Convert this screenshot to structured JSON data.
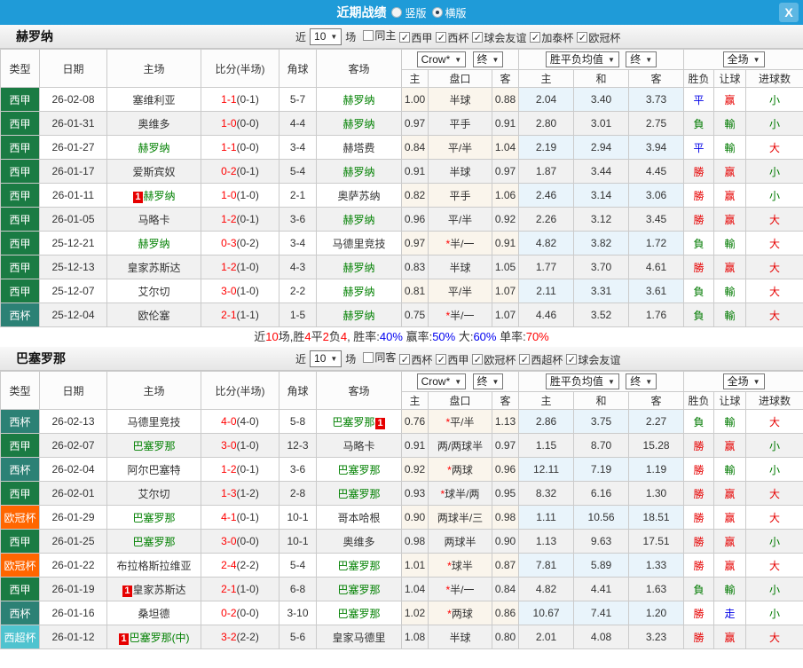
{
  "topbar": {
    "title": "近期战绩",
    "radios": [
      {
        "label": "竖版",
        "selected": false
      },
      {
        "label": "横版",
        "selected": true
      }
    ],
    "close_label": "X"
  },
  "league_colors": {
    "西甲": "#1A7B43",
    "西杯": "#2C8175",
    "欧冠杯": "#FF6600",
    "西超杯": "#4FC3CF"
  },
  "result_colors": {
    "勝": "red",
    "平": "blue",
    "負": "green",
    "赢": "red",
    "輸": "green",
    "走": "blue",
    "大": "red",
    "小": "green"
  },
  "table_header": {
    "main": [
      "类型",
      "日期",
      "主场",
      "比分(半场)",
      "角球",
      "客场"
    ],
    "sub": [
      "主",
      "盘口",
      "客",
      "主",
      "和",
      "客",
      "胜负",
      "让球",
      "进球数"
    ],
    "dropdowns": {
      "crow": "Crow*",
      "final1": "终",
      "avg": "胜平负均值",
      "final2": "终",
      "full": "全场"
    }
  },
  "sections": [
    {
      "team": "赫罗纳",
      "filter": {
        "near_label": "近",
        "count": "10",
        "games_label": "场",
        "checkboxes": [
          {
            "label": "同主",
            "checked": false
          },
          {
            "label": "西甲",
            "checked": true
          },
          {
            "label": "西杯",
            "checked": true
          },
          {
            "label": "球会友谊",
            "checked": true
          },
          {
            "label": "加泰杯",
            "checked": true
          },
          {
            "label": "欧冠杯",
            "checked": true
          }
        ]
      },
      "rows": [
        {
          "type": "西甲",
          "date": "26-02-08",
          "home": "塞维利亚",
          "home_green": false,
          "home_badge": false,
          "away": "赫罗纳",
          "away_green": true,
          "away_badge": false,
          "ft": "1-1",
          "half": "0-1",
          "corners": "5-7",
          "odds1": "1.00",
          "handicap": "半球",
          "odds2": "0.88",
          "avg": [
            "2.04",
            "3.40",
            "3.73"
          ],
          "result": "平",
          "let": "赢",
          "goals": "小"
        },
        {
          "type": "西甲",
          "date": "26-01-31",
          "home": "奥维多",
          "home_green": false,
          "home_badge": false,
          "away": "赫罗纳",
          "away_green": true,
          "away_badge": false,
          "ft": "1-0",
          "half": "0-0",
          "corners": "4-4",
          "odds1": "0.97",
          "handicap": "平手",
          "odds2": "0.91",
          "avg": [
            "2.80",
            "3.01",
            "2.75"
          ],
          "result": "負",
          "let": "輸",
          "goals": "小"
        },
        {
          "type": "西甲",
          "date": "26-01-27",
          "home": "赫罗纳",
          "home_green": true,
          "home_badge": false,
          "away": "赫塔费",
          "away_green": false,
          "away_badge": false,
          "ft": "1-1",
          "half": "0-0",
          "corners": "3-4",
          "odds1": "0.84",
          "handicap": "平/半",
          "odds2": "1.04",
          "avg": [
            "2.19",
            "2.94",
            "3.94"
          ],
          "result": "平",
          "let": "輸",
          "goals": "大"
        },
        {
          "type": "西甲",
          "date": "26-01-17",
          "home": "爱斯宾奴",
          "home_green": false,
          "home_badge": false,
          "away": "赫罗纳",
          "away_green": true,
          "away_badge": false,
          "ft": "0-2",
          "half": "0-1",
          "corners": "5-4",
          "odds1": "0.91",
          "handicap": "半球",
          "odds2": "0.97",
          "avg": [
            "1.87",
            "3.44",
            "4.45"
          ],
          "result": "勝",
          "let": "赢",
          "goals": "小"
        },
        {
          "type": "西甲",
          "date": "26-01-11",
          "home": "赫罗纳",
          "home_green": true,
          "home_badge": true,
          "away": "奥萨苏纳",
          "away_green": false,
          "away_badge": false,
          "ft": "1-0",
          "half": "1-0",
          "corners": "2-1",
          "odds1": "0.82",
          "handicap": "平手",
          "odds2": "1.06",
          "avg": [
            "2.46",
            "3.14",
            "3.06"
          ],
          "result": "勝",
          "let": "赢",
          "goals": "小"
        },
        {
          "type": "西甲",
          "date": "26-01-05",
          "home": "马略卡",
          "home_green": false,
          "home_badge": false,
          "away": "赫罗纳",
          "away_green": true,
          "away_badge": false,
          "ft": "1-2",
          "half": "0-1",
          "corners": "3-6",
          "odds1": "0.96",
          "handicap": "平/半",
          "odds2": "0.92",
          "avg": [
            "2.26",
            "3.12",
            "3.45"
          ],
          "result": "勝",
          "let": "赢",
          "goals": "大"
        },
        {
          "type": "西甲",
          "date": "25-12-21",
          "home": "赫罗纳",
          "home_green": true,
          "home_badge": false,
          "away": "马德里竞技",
          "away_green": false,
          "away_badge": false,
          "ft": "0-3",
          "half": "0-2",
          "corners": "3-4",
          "odds1": "0.97",
          "handicap": "*半/一",
          "odds2": "0.91",
          "avg": [
            "4.82",
            "3.82",
            "1.72"
          ],
          "result": "負",
          "let": "輸",
          "goals": "大"
        },
        {
          "type": "西甲",
          "date": "25-12-13",
          "home": "皇家苏斯达",
          "home_green": false,
          "home_badge": false,
          "away": "赫罗纳",
          "away_green": true,
          "away_badge": false,
          "ft": "1-2",
          "half": "1-0",
          "corners": "4-3",
          "odds1": "0.83",
          "handicap": "半球",
          "odds2": "1.05",
          "avg": [
            "1.77",
            "3.70",
            "4.61"
          ],
          "result": "勝",
          "let": "赢",
          "goals": "大"
        },
        {
          "type": "西甲",
          "date": "25-12-07",
          "home": "艾尔切",
          "home_green": false,
          "home_badge": false,
          "away": "赫罗纳",
          "away_green": true,
          "away_badge": false,
          "ft": "3-0",
          "half": "1-0",
          "corners": "2-2",
          "odds1": "0.81",
          "handicap": "平/半",
          "odds2": "1.07",
          "avg": [
            "2.11",
            "3.31",
            "3.61"
          ],
          "result": "負",
          "let": "輸",
          "goals": "大"
        },
        {
          "type": "西杯",
          "date": "25-12-04",
          "home": "欧伦塞",
          "home_green": false,
          "home_badge": false,
          "away": "赫罗纳",
          "away_green": true,
          "away_badge": false,
          "ft": "2-1",
          "half": "1-1",
          "corners": "1-5",
          "odds1": "0.75",
          "handicap": "*半/一",
          "odds2": "1.07",
          "avg": [
            "4.46",
            "3.52",
            "1.76"
          ],
          "result": "負",
          "let": "輸",
          "goals": "大"
        }
      ],
      "summary": [
        {
          "t": "近",
          "c": "k"
        },
        {
          "t": "10",
          "c": "r"
        },
        {
          "t": "场,胜",
          "c": "k"
        },
        {
          "t": "4",
          "c": "r"
        },
        {
          "t": "平",
          "c": "k"
        },
        {
          "t": "2",
          "c": "r"
        },
        {
          "t": "负",
          "c": "k"
        },
        {
          "t": "4",
          "c": "r"
        },
        {
          "t": ", 胜率:",
          "c": "k"
        },
        {
          "t": "40%",
          "c": "b"
        },
        {
          "t": " 赢率:",
          "c": "k"
        },
        {
          "t": "50%",
          "c": "b"
        },
        {
          "t": " 大:",
          "c": "k"
        },
        {
          "t": "60%",
          "c": "b"
        },
        {
          "t": " 单率:",
          "c": "k"
        },
        {
          "t": "70%",
          "c": "r"
        }
      ]
    },
    {
      "team": "巴塞罗那",
      "filter": {
        "near_label": "近",
        "count": "10",
        "games_label": "场",
        "checkboxes": [
          {
            "label": "同客",
            "checked": false
          },
          {
            "label": "西杯",
            "checked": true
          },
          {
            "label": "西甲",
            "checked": true
          },
          {
            "label": "欧冠杯",
            "checked": true
          },
          {
            "label": "西超杯",
            "checked": true
          },
          {
            "label": "球会友谊",
            "checked": true
          }
        ]
      },
      "rows": [
        {
          "type": "西杯",
          "date": "26-02-13",
          "home": "马德里竞技",
          "home_green": false,
          "home_badge": false,
          "away": "巴塞罗那",
          "away_green": true,
          "away_badge": true,
          "ft": "4-0",
          "half": "4-0",
          "corners": "5-8",
          "odds1": "0.76",
          "handicap": "*平/半",
          "odds2": "1.13",
          "avg": [
            "2.86",
            "3.75",
            "2.27"
          ],
          "result": "負",
          "let": "輸",
          "goals": "大"
        },
        {
          "type": "西甲",
          "date": "26-02-07",
          "home": "巴塞罗那",
          "home_green": true,
          "home_badge": false,
          "away": "马略卡",
          "away_green": false,
          "away_badge": false,
          "ft": "3-0",
          "half": "1-0",
          "corners": "12-3",
          "odds1": "0.91",
          "handicap": "两/两球半",
          "odds2": "0.97",
          "avg": [
            "1.15",
            "8.70",
            "15.28"
          ],
          "result": "勝",
          "let": "赢",
          "goals": "小"
        },
        {
          "type": "西杯",
          "date": "26-02-04",
          "home": "阿尔巴塞特",
          "home_green": false,
          "home_badge": false,
          "away": "巴塞罗那",
          "away_green": true,
          "away_badge": false,
          "ft": "1-2",
          "half": "0-1",
          "corners": "3-6",
          "odds1": "0.92",
          "handicap": "*两球",
          "odds2": "0.96",
          "avg": [
            "12.11",
            "7.19",
            "1.19"
          ],
          "result": "勝",
          "let": "輸",
          "goals": "小"
        },
        {
          "type": "西甲",
          "date": "26-02-01",
          "home": "艾尔切",
          "home_green": false,
          "home_badge": false,
          "away": "巴塞罗那",
          "away_green": true,
          "away_badge": false,
          "ft": "1-3",
          "half": "1-2",
          "corners": "2-8",
          "odds1": "0.93",
          "handicap": "*球半/两",
          "odds2": "0.95",
          "avg": [
            "8.32",
            "6.16",
            "1.30"
          ],
          "result": "勝",
          "let": "赢",
          "goals": "大"
        },
        {
          "type": "欧冠杯",
          "date": "26-01-29",
          "home": "巴塞罗那",
          "home_green": true,
          "home_badge": false,
          "away": "哥本哈根",
          "away_green": false,
          "away_badge": false,
          "ft": "4-1",
          "half": "0-1",
          "corners": "10-1",
          "odds1": "0.90",
          "handicap": "两球半/三",
          "odds2": "0.98",
          "avg": [
            "1.11",
            "10.56",
            "18.51"
          ],
          "result": "勝",
          "let": "赢",
          "goals": "大"
        },
        {
          "type": "西甲",
          "date": "26-01-25",
          "home": "巴塞罗那",
          "home_green": true,
          "home_badge": false,
          "away": "奥维多",
          "away_green": false,
          "away_badge": false,
          "ft": "3-0",
          "half": "0-0",
          "corners": "10-1",
          "odds1": "0.98",
          "handicap": "两球半",
          "odds2": "0.90",
          "avg": [
            "1.13",
            "9.63",
            "17.51"
          ],
          "result": "勝",
          "let": "赢",
          "goals": "小"
        },
        {
          "type": "欧冠杯",
          "date": "26-01-22",
          "home": "布拉格斯拉维亚",
          "home_green": false,
          "home_badge": false,
          "away": "巴塞罗那",
          "away_green": true,
          "away_badge": false,
          "ft": "2-4",
          "half": "2-2",
          "corners": "5-4",
          "odds1": "1.01",
          "handicap": "*球半",
          "odds2": "0.87",
          "avg": [
            "7.81",
            "5.89",
            "1.33"
          ],
          "result": "勝",
          "let": "赢",
          "goals": "大"
        },
        {
          "type": "西甲",
          "date": "26-01-19",
          "home": "皇家苏斯达",
          "home_green": false,
          "home_badge": true,
          "away": "巴塞罗那",
          "away_green": true,
          "away_badge": false,
          "ft": "2-1",
          "half": "1-0",
          "corners": "6-8",
          "odds1": "1.04",
          "handicap": "*半/一",
          "odds2": "0.84",
          "avg": [
            "4.82",
            "4.41",
            "1.63"
          ],
          "result": "負",
          "let": "輸",
          "goals": "小"
        },
        {
          "type": "西杯",
          "date": "26-01-16",
          "home": "桑坦德",
          "home_green": false,
          "home_badge": false,
          "away": "巴塞罗那",
          "away_green": true,
          "away_badge": false,
          "ft": "0-2",
          "half": "0-0",
          "corners": "3-10",
          "odds1": "1.02",
          "handicap": "*两球",
          "odds2": "0.86",
          "avg": [
            "10.67",
            "7.41",
            "1.20"
          ],
          "result": "勝",
          "let": "走",
          "goals": "小"
        },
        {
          "type": "西超杯",
          "date": "26-01-12",
          "home": "巴塞罗那(中)",
          "home_green": true,
          "home_badge": true,
          "away": "皇家马德里",
          "away_green": false,
          "away_badge": false,
          "ft": "3-2",
          "half": "2-2",
          "corners": "5-6",
          "odds1": "1.08",
          "handicap": "半球",
          "odds2": "0.80",
          "avg": [
            "2.01",
            "4.08",
            "3.23"
          ],
          "result": "勝",
          "let": "赢",
          "goals": "大"
        }
      ],
      "summary": null
    }
  ]
}
